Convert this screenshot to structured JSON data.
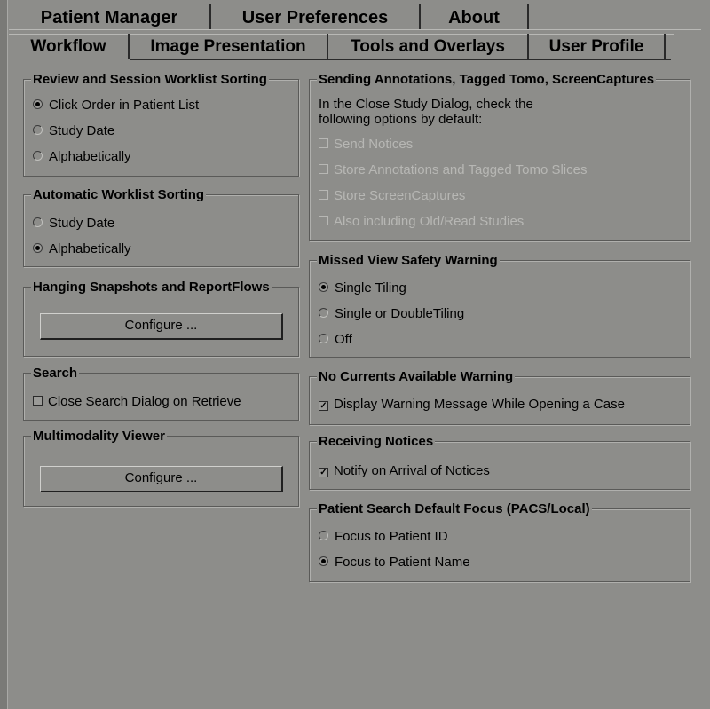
{
  "top_tabs": [
    "Patient Manager",
    "User Preferences",
    "About"
  ],
  "active_top_tab": "User Preferences",
  "sub_tabs": [
    "Workflow",
    "Image Presentation",
    "Tools and Overlays",
    "User Profile"
  ],
  "active_sub_tab": "Workflow",
  "review_sorting": {
    "title": "Review and Session Worklist Sorting",
    "options": [
      {
        "label": "Click Order in Patient List",
        "selected": true
      },
      {
        "label": "Study Date",
        "selected": false
      },
      {
        "label": "Alphabetically",
        "selected": false
      }
    ]
  },
  "auto_sorting": {
    "title": "Automatic Worklist Sorting",
    "options": [
      {
        "label": "Study Date",
        "selected": false
      },
      {
        "label": "Alphabetically",
        "selected": true
      }
    ]
  },
  "hanging": {
    "title": "Hanging Snapshots and ReportFlows",
    "button": "Configure ..."
  },
  "search": {
    "title": "Search",
    "checkbox": {
      "label": "Close Search Dialog on Retrieve",
      "checked": false
    }
  },
  "multimodality": {
    "title": "Multimodality Viewer",
    "button": "Configure ..."
  },
  "sending": {
    "title": "Sending Annotations, Tagged Tomo, ScreenCaptures",
    "description_line1": "In the Close Study Dialog, check the",
    "description_line2": "following options by default:",
    "options": [
      {
        "label": "Send Notices",
        "checked": false,
        "enabled": false
      },
      {
        "label": "Store Annotations and Tagged Tomo Slices",
        "checked": false,
        "enabled": false
      },
      {
        "label": "Store ScreenCaptures",
        "checked": false,
        "enabled": false
      },
      {
        "label": "Also including Old/Read Studies",
        "checked": false,
        "enabled": false
      }
    ]
  },
  "missed_view": {
    "title": "Missed View Safety Warning",
    "options": [
      {
        "label": "Single Tiling",
        "selected": true
      },
      {
        "label": "Single or DoubleTiling",
        "selected": false
      },
      {
        "label": "Off",
        "selected": false
      }
    ]
  },
  "no_currents": {
    "title": "No Currents Available Warning",
    "checkbox": {
      "label": "Display Warning Message While Opening a Case",
      "checked": true
    }
  },
  "receiving": {
    "title": "Receiving Notices",
    "checkbox": {
      "label": "Notify on Arrival of Notices",
      "checked": true
    }
  },
  "patient_search": {
    "title": "Patient Search Default Focus (PACS/Local)",
    "options": [
      {
        "label": "Focus to Patient ID",
        "selected": false
      },
      {
        "label": "Focus to Patient Name",
        "selected": true
      }
    ]
  }
}
